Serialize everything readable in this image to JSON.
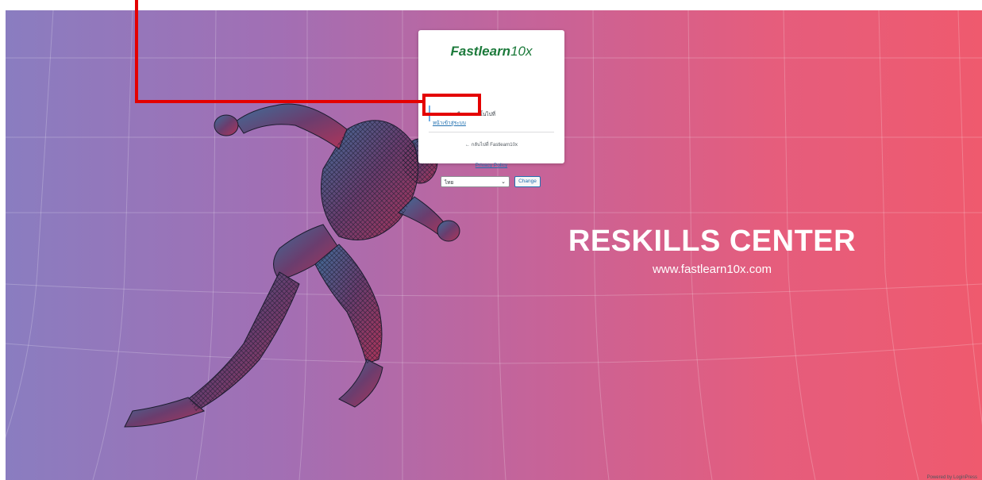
{
  "card": {
    "logo_bold": "Fastlearn",
    "logo_light": "10x",
    "notice_text": "าตรวจสอบอีเมล จากนั้นไปที่",
    "login_link": "หน้าเข้าสู่ระบบ",
    "back_link": "← กลับไปที่ Fastlearn10x",
    "privacy_link": "Privacy Policy"
  },
  "language": {
    "selected": "ไทย",
    "change_label": "Change"
  },
  "hero": {
    "headline": "RESKILLS CENTER",
    "url": "www.fastlearn10x.com"
  },
  "footer": {
    "powered_by": "Powered by LoginPress"
  },
  "colors": {
    "accent": "#2271b1",
    "brand_green": "#1c7a3b",
    "highlight": "#e40000"
  }
}
